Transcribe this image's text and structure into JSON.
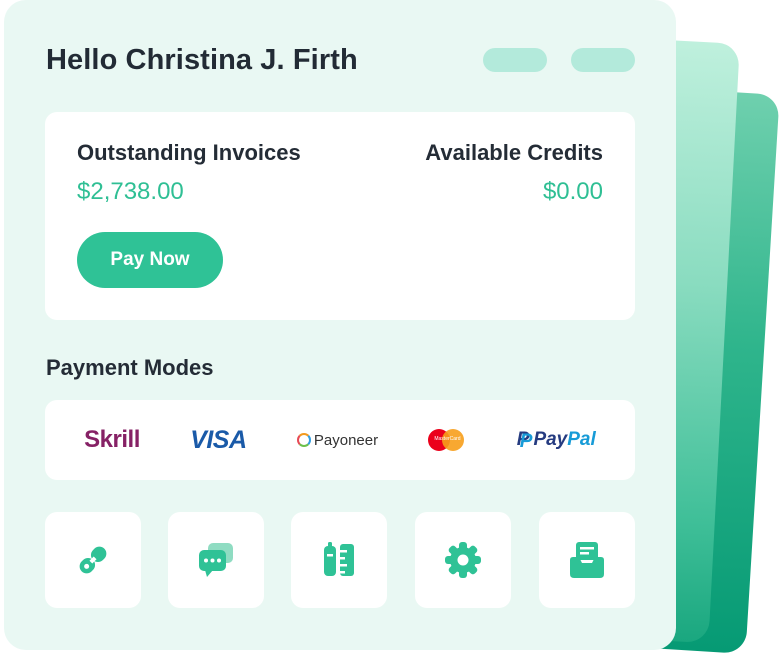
{
  "greeting": "Hello Christina J. Firth",
  "invoices": {
    "outstanding_label": "Outstanding Invoices",
    "outstanding_value": "$2,738.00",
    "credits_label": "Available Credits",
    "credits_value": "$0.00",
    "pay_button": "Pay Now"
  },
  "payment_modes": {
    "title": "Payment Modes",
    "providers": {
      "skrill": "Skrill",
      "visa": "VISA",
      "payoneer": "Payoneer",
      "mastercard": "MasterCard",
      "paypal_a": "Pay",
      "paypal_b": "Pal",
      "paypal_mark": "P"
    }
  },
  "quick_actions": [
    "link-icon",
    "chat-icon",
    "book-ruler-icon",
    "gear-icon",
    "inbox-icon"
  ],
  "colors": {
    "accent": "#2fc296",
    "card_bg": "#e9f8f3",
    "pill": "#b3eadb",
    "value_text": "#2fbf94"
  }
}
